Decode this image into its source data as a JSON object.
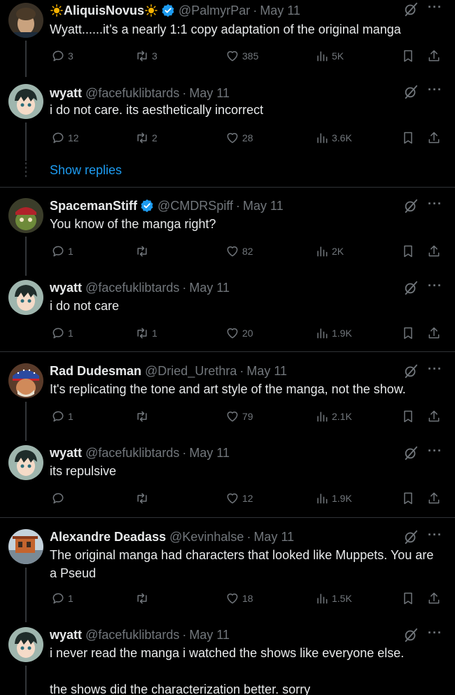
{
  "posts": [
    {
      "name": "AliquisNovus",
      "name_prefix_emoji": "sun-emoji",
      "name_suffix_emoji": "sun-emoji",
      "verified": true,
      "handle": "@PalmyrPar",
      "date": "May 11",
      "text": "Wyatt......it’s a nearly 1:1 copy adaptation of the original manga",
      "replies": "3",
      "reposts": "3",
      "likes": "385",
      "views": "5K",
      "avatar": {
        "bg": "#3a3126",
        "face": "#c9a27e",
        "hair": "#4a3a28"
      }
    },
    {
      "name": "wyatt",
      "verified": false,
      "handle": "@facefuklibtards",
      "date": "May 11",
      "text": "i do not care. its aesthetically incorrect",
      "replies": "12",
      "reposts": "2",
      "likes": "28",
      "views": "3.6K",
      "avatar": {
        "bg": "#9fb6ae",
        "face": "#f5dbc8",
        "hair": "#1f2c2a"
      }
    },
    {
      "name": "SpacemanStiff",
      "verified": true,
      "handle": "@CMDRSpiff",
      "date": "May 11",
      "text": "You know of the manga right?",
      "replies": "1",
      "reposts": "",
      "likes": "82",
      "views": "2K",
      "avatar": {
        "bg": "#3b3d2a",
        "face": "#6e8a3a",
        "hair": "#b0232a"
      }
    },
    {
      "name": "wyatt",
      "verified": false,
      "handle": "@facefuklibtards",
      "date": "May 11",
      "text": "i do not care",
      "replies": "1",
      "reposts": "1",
      "likes": "20",
      "views": "1.9K",
      "avatar": {
        "bg": "#9fb6ae",
        "face": "#f5dbc8",
        "hair": "#1f2c2a"
      }
    },
    {
      "name": "Rad Dudesman",
      "verified": false,
      "handle": "@Dried_Urethra",
      "date": "May 11",
      "text": "It's replicating the tone and art style of the manga, not the show.",
      "replies": "1",
      "reposts": "",
      "likes": "79",
      "views": "2.1K",
      "avatar": {
        "bg": "#5a3b2a",
        "face": "#d08a5a",
        "hair": "#2c4aa0"
      }
    },
    {
      "name": "wyatt",
      "verified": false,
      "handle": "@facefuklibtards",
      "date": "May 11",
      "text": "its repulsive",
      "replies": "",
      "reposts": "",
      "likes": "12",
      "views": "1.9K",
      "avatar": {
        "bg": "#9fb6ae",
        "face": "#f5dbc8",
        "hair": "#1f2c2a"
      }
    },
    {
      "name": "Alexandre Deadass",
      "verified": false,
      "handle": "@Kevinhalse",
      "date": "May 11",
      "text": "The original manga had characters that looked like Muppets. You are a Pseud",
      "replies": "1",
      "reposts": "",
      "likes": "18",
      "views": "1.5K",
      "avatar": {
        "bg": "#c4d2dc",
        "face": "#c4642e",
        "hair": "#7a8a96"
      }
    },
    {
      "name": "wyatt",
      "verified": false,
      "handle": "@facefuklibtards",
      "date": "May 11",
      "text": "i never read the manga i watched the shows like everyone else.\n\nthe shows did the characterization better. sorry",
      "replies": "",
      "reposts": "",
      "likes": "",
      "views": "",
      "avatar": {
        "bg": "#9fb6ae",
        "face": "#f5dbc8",
        "hair": "#1f2c2a"
      }
    }
  ],
  "show_replies_label": "Show replies",
  "colors": {
    "background": "#000000",
    "text": "#e7e9ea",
    "muted": "#71767b",
    "accent": "#1d9bf0",
    "divider": "#2f3336"
  }
}
